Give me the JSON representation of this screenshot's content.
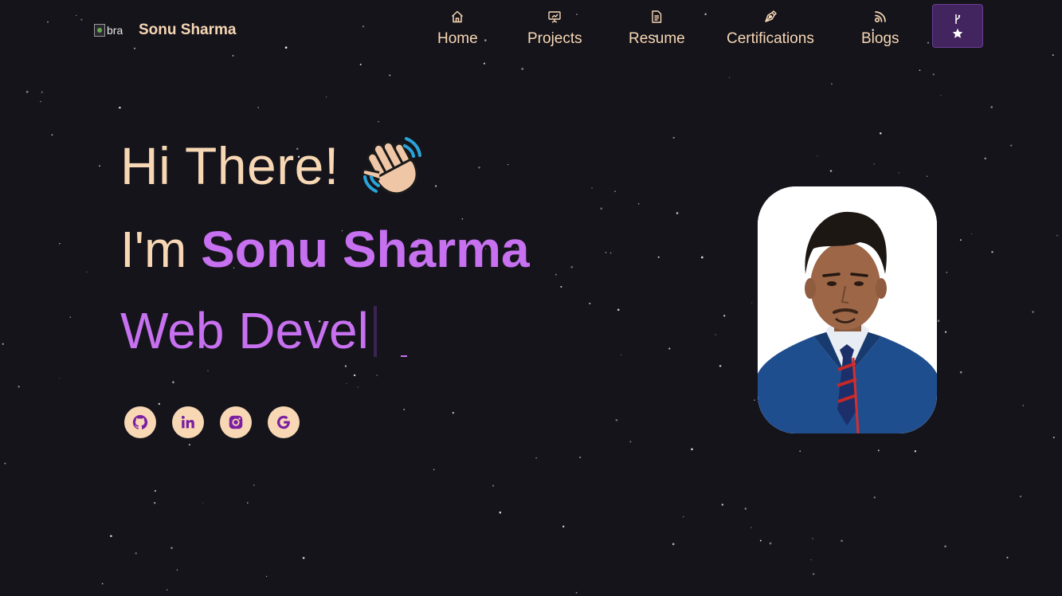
{
  "navbar": {
    "brand_alt": "brand",
    "brand_name": "Sonu Sharma",
    "items": [
      {
        "label": "Home",
        "icon": "home-icon"
      },
      {
        "label": "Projects",
        "icon": "presentation-icon"
      },
      {
        "label": "Resume",
        "icon": "document-icon"
      },
      {
        "label": "Certifications",
        "icon": "pen-nib-icon"
      },
      {
        "label": "Blogs",
        "icon": "rss-icon"
      }
    ],
    "fork_button": {
      "icons": [
        "git-branch-icon",
        "star-icon"
      ]
    }
  },
  "hero": {
    "greeting": "Hi There!",
    "wave_icon": "waving-hand-icon",
    "name_prefix": "I'm",
    "name": "Sonu Sharma",
    "typed_text": "Web Devel"
  },
  "socials": [
    {
      "icon": "github-icon"
    },
    {
      "icon": "linkedin-icon"
    },
    {
      "icon": "instagram-icon"
    },
    {
      "icon": "google-icon"
    }
  ],
  "colors": {
    "background": "#15141b",
    "text": "#f7d7b4",
    "accent": "#c770f0",
    "button": "#42255f",
    "icon_fill": "#7b1fa2"
  }
}
